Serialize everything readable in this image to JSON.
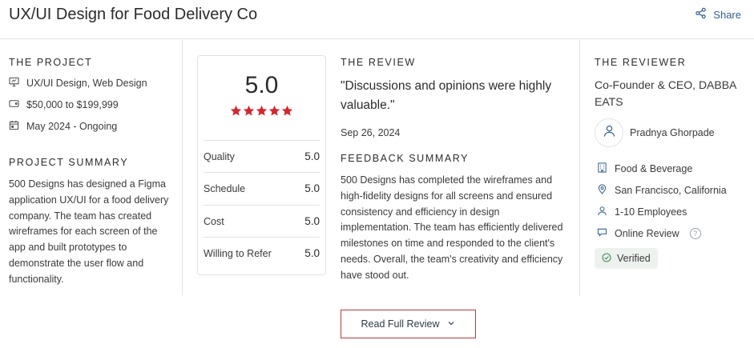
{
  "header": {
    "title": "UX/UI Design for Food Delivery Co",
    "share_label": "Share"
  },
  "project": {
    "heading": "THE PROJECT",
    "service": "UX/UI Design, Web Design",
    "budget": "$50,000 to $199,999",
    "timeline": "May 2024 - Ongoing",
    "icons": [
      "monitor-icon",
      "price-tag-icon",
      "calendar-icon"
    ]
  },
  "summary": {
    "heading": "PROJECT SUMMARY",
    "text": "500 Designs has designed a Figma application UX/UI for a food delivery company. The team has created wireframes for each screen of the app and built prototypes to demonstrate the user flow and functionality."
  },
  "rating": {
    "overall": "5.0",
    "stars": 5,
    "star_color": "#d6252c",
    "rows": [
      {
        "label": "Quality",
        "value": "5.0"
      },
      {
        "label": "Schedule",
        "value": "5.0"
      },
      {
        "label": "Cost",
        "value": "5.0"
      },
      {
        "label": "Willing to Refer",
        "value": "5.0"
      }
    ]
  },
  "review": {
    "heading": "THE REVIEW",
    "quote": "\"Discussions and opinions were highly valuable.\"",
    "date": "Sep 26, 2024",
    "feedback_heading": "FEEDBACK SUMMARY",
    "feedback_text": "500 Designs has completed the wireframes and high-fidelity designs for all screens and ensured consistency and efficiency in design implementation. The team has efficiently delivered milestones on time and responded to the client's needs. Overall, the team's creativity and efficiency have stood out."
  },
  "reviewer": {
    "heading": "THE REVIEWER",
    "role": "Co-Founder & CEO, DABBA EATS",
    "name": "Pradnya Ghorpade",
    "industry": "Food & Beverage",
    "location": "San Francisco, California",
    "employees": "1-10 Employees",
    "review_type": "Online Review",
    "help_glyph": "?",
    "verified": "Verified"
  },
  "actions": {
    "read_full_review": "Read Full Review"
  },
  "colors": {
    "accent": "#b53a3a",
    "link": "#2f5f8c",
    "divider": "#dfe3e6",
    "verified_bg": "#eef2ef",
    "verified_icon": "#3f8f5b"
  }
}
